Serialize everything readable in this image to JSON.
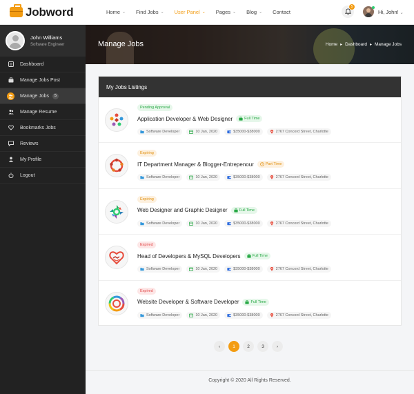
{
  "brand": {
    "name": "Jobword",
    "accent": "#f39c12"
  },
  "nav": {
    "items": [
      {
        "label": "Home",
        "has_dropdown": true,
        "active": false
      },
      {
        "label": "Find Jobs",
        "has_dropdown": true,
        "active": false
      },
      {
        "label": "User Panel",
        "has_dropdown": true,
        "active": true
      },
      {
        "label": "Pages",
        "has_dropdown": true,
        "active": false
      },
      {
        "label": "Blog",
        "has_dropdown": true,
        "active": false
      },
      {
        "label": "Contact",
        "has_dropdown": false,
        "active": false
      }
    ],
    "notification_count": "5",
    "greeting": "Hi, John!"
  },
  "sidebar": {
    "profile": {
      "name": "John Williams",
      "role": "Software Engineer"
    },
    "items": [
      {
        "label": "Dashboard",
        "icon": "dashboard-icon"
      },
      {
        "label": "Manage Jobs Post",
        "icon": "briefcase-icon"
      },
      {
        "label": "Manage Jobs",
        "icon": "users-icon",
        "badge": "5",
        "active": true
      },
      {
        "label": "Manage Resume",
        "icon": "user-group-icon"
      },
      {
        "label": "Bookmarks Jobs",
        "icon": "heart-icon"
      },
      {
        "label": "Reviews",
        "icon": "comment-icon"
      },
      {
        "label": "My Profile",
        "icon": "user-icon"
      },
      {
        "label": "Logout",
        "icon": "power-icon"
      }
    ]
  },
  "banner": {
    "title": "Manage Jobs",
    "breadcrumb": [
      "Home",
      "Dashboard",
      "Manage Jobs"
    ]
  },
  "listings": {
    "heading": "My Jobs Listings",
    "jobs": [
      {
        "status": "Pending Approval",
        "status_kind": "pending",
        "title": "Application Developer & Web Designer",
        "type": "Full Time",
        "type_kind": "full",
        "category": "Software Developer",
        "date": "10 Jan, 2020",
        "salary": "$35000-$38000",
        "location": "2767 Concord Street, Charlotte",
        "logo": "people-circle-logo"
      },
      {
        "status": "Expiring",
        "status_kind": "expiring",
        "title": "IT Department Manager & Blogger-Entrepenour",
        "type": "Part Time",
        "type_kind": "part",
        "category": "Software Developer",
        "date": "10 Jan, 2020",
        "salary": "$35000-$38000",
        "location": "2767 Concord Street, Charlotte",
        "logo": "people-ring-logo"
      },
      {
        "status": "Expiring",
        "status_kind": "expiring",
        "title": "Web Designer and Graphic Designer",
        "type": "Full Time",
        "type_kind": "full",
        "category": "Software Developer",
        "date": "10 Jan, 2020",
        "salary": "$35000-$38000",
        "location": "2767 Concord Street, Charlotte",
        "logo": "arrows-circle-logo"
      },
      {
        "status": "Expired",
        "status_kind": "expired",
        "title": "Head of Developers & MySQL Developers",
        "type": "Full Time",
        "type_kind": "full",
        "category": "Software Developer",
        "date": "10 Jan, 2020",
        "salary": "$35000-$38000",
        "location": "2767 Concord Street, Charlotte",
        "logo": "heart-hands-logo"
      },
      {
        "status": "Expired",
        "status_kind": "expired",
        "title": "Website Developer & Software Developer",
        "type": "Full Time",
        "type_kind": "full",
        "category": "Software Developer",
        "date": "10 Jan, 2020",
        "salary": "$35000-$38000",
        "location": "2767 Concord Street, Charlotte",
        "logo": "color-wheel-logo"
      }
    ]
  },
  "pagination": {
    "prev": "‹",
    "pages": [
      "1",
      "2",
      "3"
    ],
    "current": "1",
    "next": "›"
  },
  "footer": {
    "copyright": "Copyright © 2020 All Rights Reserved."
  }
}
